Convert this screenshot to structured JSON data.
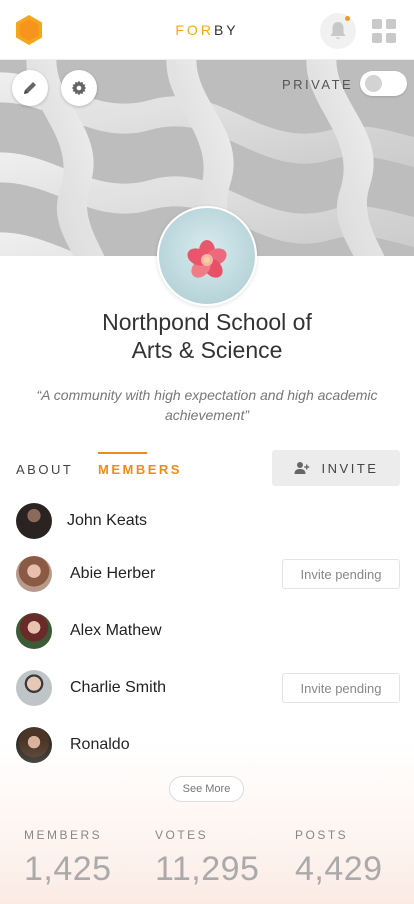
{
  "header": {
    "brand_part1": "FOR",
    "brand_part2": "BY"
  },
  "cover": {
    "privacy_label": "PRIVATE",
    "privacy_enabled": false
  },
  "organization": {
    "name_line1": "Northpond School of",
    "name_line2": "Arts & Science",
    "quote": "“A community with high expectation and high academic achievement”"
  },
  "tabs": [
    {
      "label": "ABOUT",
      "active": false
    },
    {
      "label": "MEMBERS",
      "active": true
    }
  ],
  "invite_button": {
    "label": "INVITE"
  },
  "members": [
    {
      "name": "John Keats",
      "status": ""
    },
    {
      "name": "Abie Herber",
      "status": "Invite pending"
    },
    {
      "name": "Alex Mathew",
      "status": ""
    },
    {
      "name": "Charlie Smith",
      "status": "Invite pending"
    },
    {
      "name": "Ronaldo",
      "status": ""
    }
  ],
  "see_more": {
    "label": "See More"
  },
  "stats": [
    {
      "label": "MEMBERS",
      "value": "1,425"
    },
    {
      "label": "VOTES",
      "value": "11,295"
    },
    {
      "label": "POSTS",
      "value": "4,429"
    }
  ],
  "colors": {
    "accent": "#f08c14",
    "brand_orange": "#f3a81b"
  },
  "icons": [
    "hexagon-logo-icon",
    "bell-icon",
    "apps-grid-icon",
    "pencil-icon",
    "gear-icon",
    "add-user-icon",
    "flower-icon"
  ]
}
